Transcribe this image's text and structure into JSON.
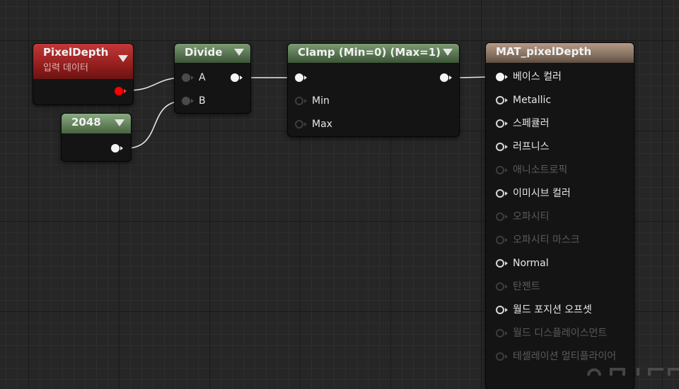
{
  "graph": {
    "pixel_depth_node": {
      "title": "PixelDepth",
      "subtitle": "입력 데이터",
      "output_color": "#ff0000"
    },
    "constant_node": {
      "title": "2048"
    },
    "divide_node": {
      "title": "Divide",
      "inputs": [
        "A",
        "B"
      ]
    },
    "clamp_node": {
      "title": "Clamp (Min=0) (Max=1)",
      "inputs": [
        "Min",
        "Max"
      ]
    },
    "material_node": {
      "title": "MAT_pixelDepth",
      "pins": [
        {
          "label": "베이스 컬러",
          "state": "connected"
        },
        {
          "label": "Metallic",
          "state": "enabled"
        },
        {
          "label": "스페큘러",
          "state": "enabled"
        },
        {
          "label": "러프니스",
          "state": "enabled"
        },
        {
          "label": "애니소트로픽",
          "state": "disabled"
        },
        {
          "label": "이미시브 컬러",
          "state": "enabled"
        },
        {
          "label": "오파시티",
          "state": "disabled"
        },
        {
          "label": "오파시티 마스크",
          "state": "disabled"
        },
        {
          "label": "Normal",
          "state": "enabled"
        },
        {
          "label": "탄젠트",
          "state": "disabled"
        },
        {
          "label": "월드 포지션 오프셋",
          "state": "enabled"
        },
        {
          "label": "월드 디스플레이스먼트",
          "state": "disabled"
        },
        {
          "label": "테셀레이션 멀티플라이어",
          "state": "disabled"
        }
      ]
    }
  },
  "colors": {
    "background": "#262626",
    "wire": "#e8e8e8",
    "pixel_depth_header": "#8c1a1a",
    "math_header": "#4e6a48",
    "material_header": "#7e6a5a"
  }
}
